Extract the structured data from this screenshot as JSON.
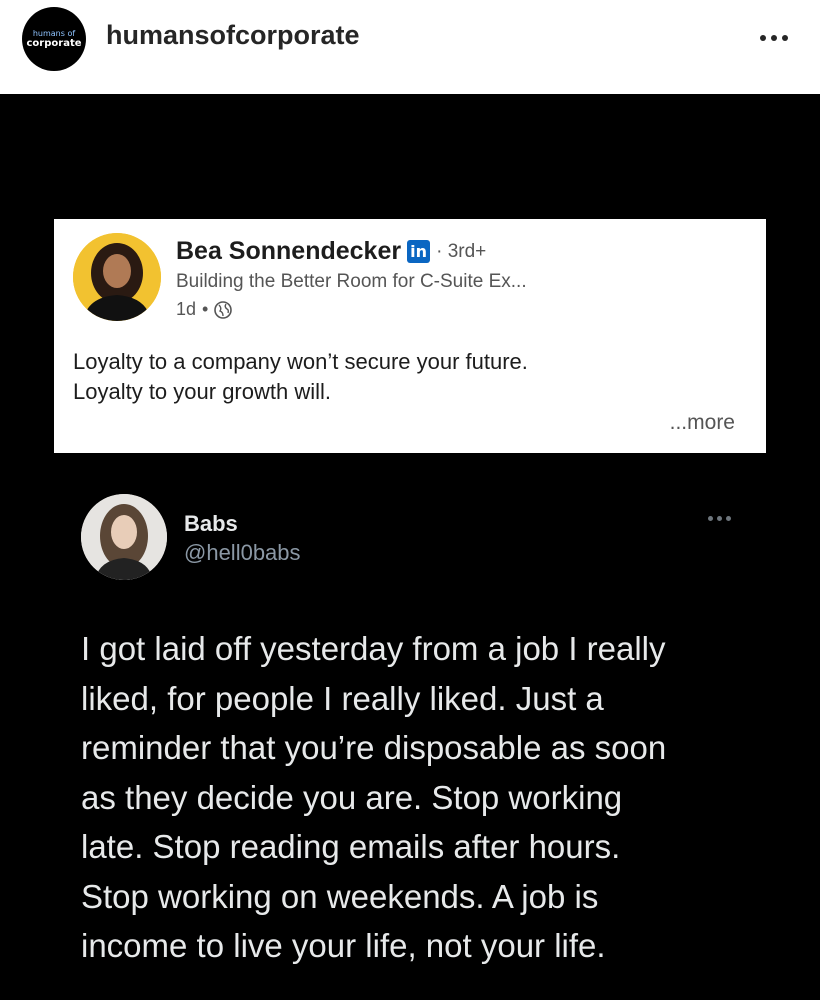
{
  "instagram": {
    "username": "humansofcorporate",
    "logo_line1": "humans of",
    "logo_line2": "corporate",
    "more_icon": "more-horizontal-icon"
  },
  "linkedin": {
    "name": "Bea Sonnendecker",
    "badge": "in",
    "degree": "· 3rd+",
    "headline": "Building the Better Room for C-Suite Ex...",
    "time": "1d",
    "dot": "•",
    "visibility_icon": "globe-icon",
    "post_lines": [
      "Loyalty to a company won’t secure your future.",
      "Loyalty to your growth will."
    ],
    "more_label": "...more"
  },
  "tweet": {
    "name": "Babs",
    "handle": "@hell0babs",
    "lines": [
      "I got laid off yesterday from a job I really",
      "liked, for people I really liked. Just a",
      "reminder that you’re disposable as soon",
      "as they decide you are. Stop working",
      "late. Stop reading emails after hours.",
      "Stop working on weekends. A job is",
      "income to live your life, not your life."
    ]
  },
  "colors": {
    "background": "#000000",
    "linkedin_blue": "#0a66c2",
    "avatar_yellow": "#f2c230"
  }
}
